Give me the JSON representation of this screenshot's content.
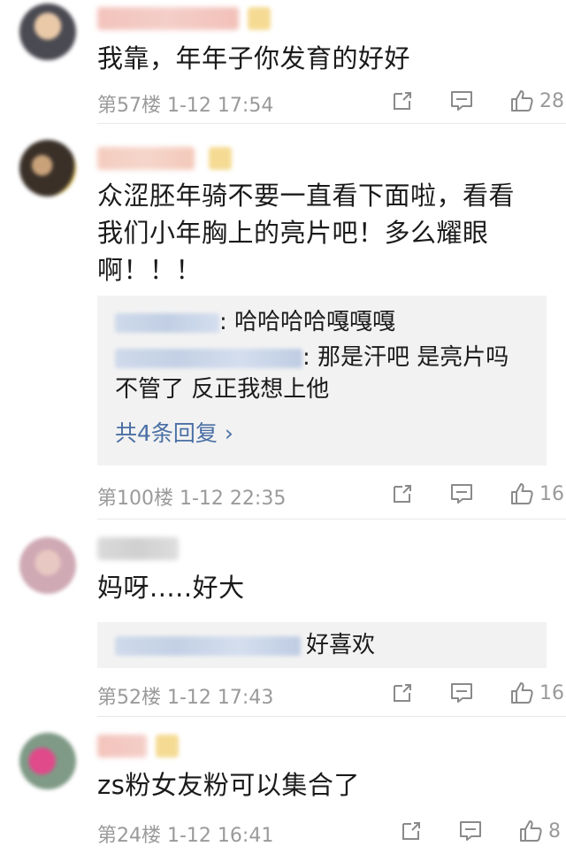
{
  "comments": [
    {
      "text_lines": [
        "我靠，年年子你发育的好好"
      ],
      "floor": "第57楼",
      "time": "1-12 17:54",
      "likes": "28"
    },
    {
      "text_lines": [
        "众涩胚年骑不要一直看下面啦，看看",
        "我们小年胸上的亮片吧！多么耀眼",
        "啊！！！"
      ],
      "replies": [
        {
          "text": ": 哈哈哈哈嘎嘎嘎"
        },
        {
          "text": ": 那是汗吧 是亮片吗",
          "text2": "不管了 反正我想上他"
        }
      ],
      "more_replies": "共4条回复 ›",
      "floor": "第100楼",
      "time": "1-12 22:35",
      "likes": "16"
    },
    {
      "text_lines": [
        "妈呀.....好大"
      ],
      "replies": [
        {
          "text": "好喜欢"
        }
      ],
      "floor": "第52楼",
      "time": "1-12 17:43",
      "likes": "16"
    },
    {
      "text_lines": [
        "zs粉女友粉可以集合了"
      ],
      "floor": "第24楼",
      "time": "1-12 16:41",
      "likes": "8"
    }
  ],
  "icons": {
    "share": "share-icon",
    "reply": "comment-icon",
    "like": "thumbs-up-icon"
  },
  "colors": {
    "link": "#4a6fa5",
    "meta": "#9a9a9a",
    "reply_bg": "#f2f2f2"
  }
}
